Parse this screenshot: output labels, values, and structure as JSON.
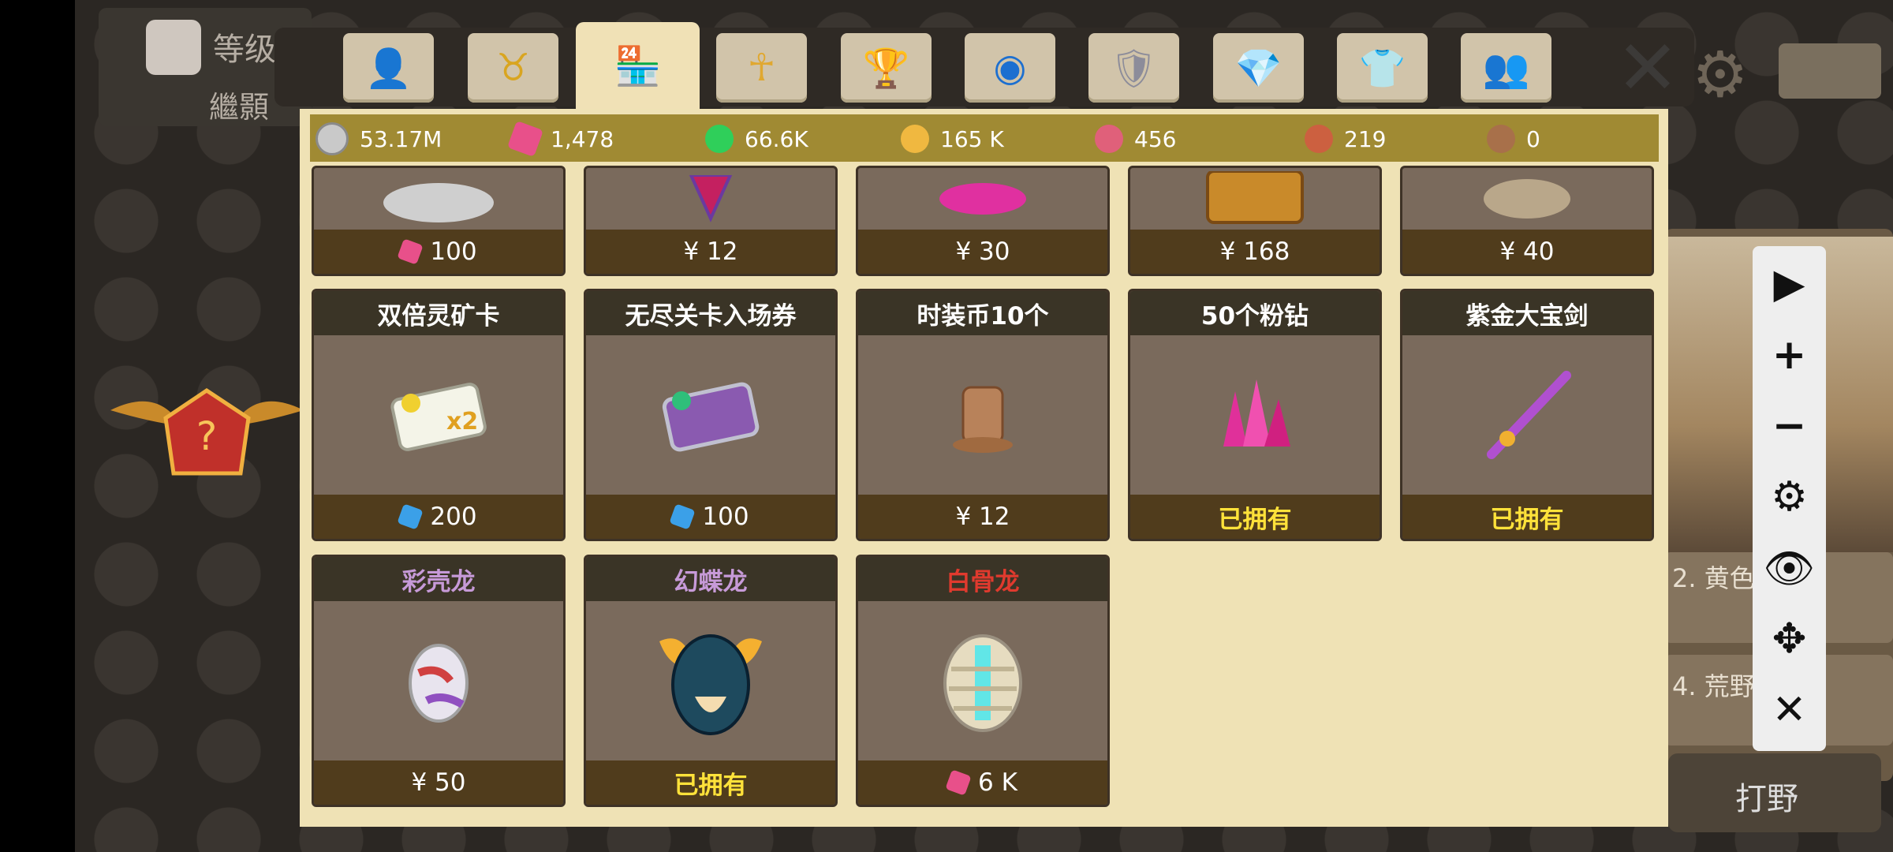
{
  "background": {
    "level_label": "等级",
    "sub_label": "繼顥",
    "right_card_1": "2. 黄色",
    "right_card_2": "4. 荒野求生",
    "right_button": "打野"
  },
  "tabs": [
    {
      "name": "profile",
      "icon": "person-icon"
    },
    {
      "name": "dragon",
      "icon": "dragon-head-icon"
    },
    {
      "name": "shop",
      "icon": "shop-icon",
      "active": true
    },
    {
      "name": "ankh",
      "icon": "ankh-icon"
    },
    {
      "name": "trophy",
      "icon": "trophy-icon"
    },
    {
      "name": "orb",
      "icon": "orb-icon"
    },
    {
      "name": "armor",
      "icon": "armor-icon"
    },
    {
      "name": "gem",
      "icon": "gem-icon"
    },
    {
      "name": "costume",
      "icon": "shirt-icon"
    },
    {
      "name": "friends",
      "icon": "friends-icon"
    }
  ],
  "currency": {
    "silver": "53.17M",
    "pink_gem": "1,478",
    "green_orb": "66.6K",
    "gold_dragon": "165 K",
    "pink_dragon": "456",
    "red_dragon": "219",
    "coin": "0"
  },
  "top_row_prices": [
    "100",
    "¥ 12",
    "¥ 30",
    "¥ 168",
    "¥ 40"
  ],
  "items_row2": [
    {
      "title": "双倍灵矿卡",
      "price": "200",
      "price_icon": "blue-gem"
    },
    {
      "title": "无尽关卡入场券",
      "price": "100",
      "price_icon": "blue-gem"
    },
    {
      "title": "时装币10个",
      "price": "¥ 12"
    },
    {
      "title": "50个粉钻",
      "price": "已拥有",
      "owned": true
    },
    {
      "title": "紫金大宝剑",
      "price": "已拥有",
      "owned": true
    }
  ],
  "items_row3": [
    {
      "title": "彩壳龙",
      "price": "¥ 50",
      "title_color": "#c79ad8"
    },
    {
      "title": "幻蝶龙",
      "price": "已拥有",
      "owned": true,
      "title_color": "#c79ad8"
    },
    {
      "title": "白骨龙",
      "price": "6 K",
      "price_icon": "pink-gem",
      "title_color": "#e03a2e"
    }
  ],
  "controls": [
    "play",
    "plus",
    "minus",
    "settings",
    "eye",
    "move",
    "close"
  ]
}
